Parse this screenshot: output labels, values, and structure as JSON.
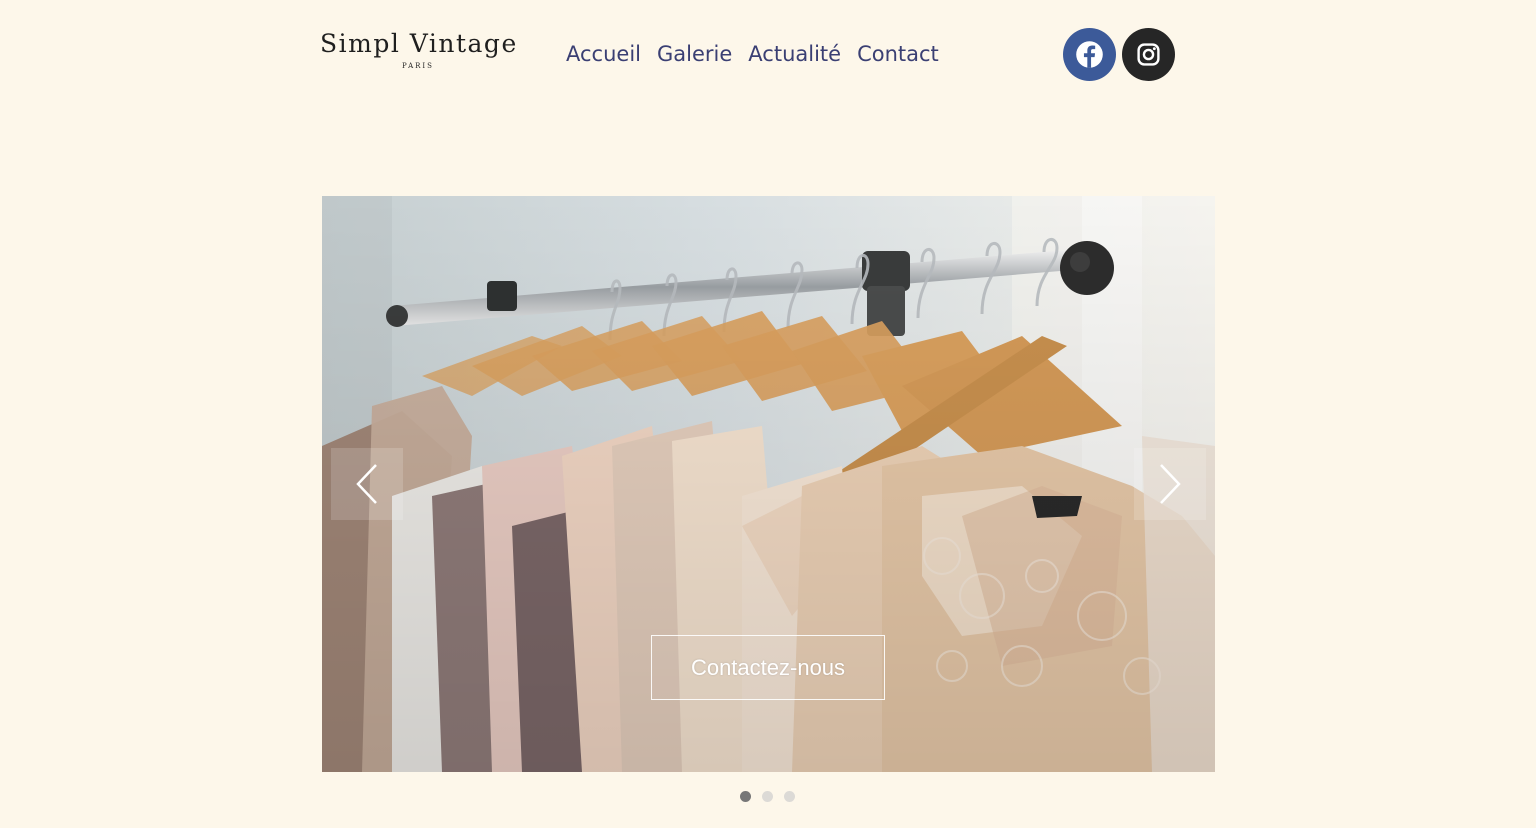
{
  "brand": {
    "name": "Simpl Vintage",
    "city": "PARIS"
  },
  "nav": {
    "items": [
      {
        "label": "Accueil"
      },
      {
        "label": "Galerie"
      },
      {
        "label": "Actualité"
      },
      {
        "label": "Contact"
      }
    ]
  },
  "social": {
    "facebook_icon": "facebook-icon",
    "instagram_icon": "instagram-icon",
    "facebook_color": "#3c5a99",
    "instagram_color": "#262626"
  },
  "slider": {
    "cta_label": "Contactez-nous",
    "prev_icon": "chevron-left-icon",
    "next_icon": "chevron-right-icon",
    "slide_count": 3,
    "active_slide": 1
  },
  "colors": {
    "background": "#fdf7ea",
    "nav_text": "#3a3f73"
  }
}
